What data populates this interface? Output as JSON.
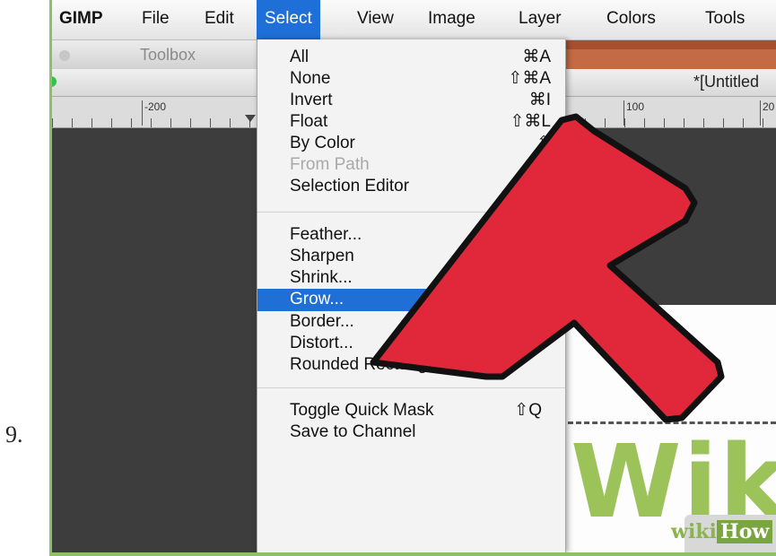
{
  "step_number": "9.",
  "menubar": {
    "items": [
      "GIMP",
      "File",
      "Edit",
      "Select",
      "View",
      "Image",
      "Layer",
      "Colors",
      "Tools"
    ]
  },
  "toolbox": {
    "title": "Toolbox"
  },
  "image_window": {
    "title": "*[Untitled"
  },
  "ruler": {
    "labels": [
      "-200",
      "100",
      "20"
    ]
  },
  "select_menu": {
    "items": [
      {
        "label": "All",
        "shortcut": "⌘A"
      },
      {
        "label": "None",
        "shortcut": "⇧⌘A"
      },
      {
        "label": "Invert",
        "shortcut": "⌘I"
      },
      {
        "label": "Float",
        "shortcut": "⇧⌘L"
      },
      {
        "label": "By Color",
        "shortcut": "⇧"
      },
      {
        "label": "From Path",
        "shortcut": ""
      },
      {
        "label": "Selection Editor",
        "shortcut": ""
      },
      {
        "label": "Feather...",
        "shortcut": ""
      },
      {
        "label": "Sharpen",
        "shortcut": ""
      },
      {
        "label": "Shrink...",
        "shortcut": ""
      },
      {
        "label": "Grow...",
        "shortcut": ""
      },
      {
        "label": "Border...",
        "shortcut": ""
      },
      {
        "label": "Distort...",
        "shortcut": ""
      },
      {
        "label": "Rounded Rectangle...",
        "shortcut": ""
      },
      {
        "label": "Toggle Quick Mask",
        "shortcut": "⇧Q"
      },
      {
        "label": "Save to Channel",
        "shortcut": ""
      }
    ],
    "disabled": [
      "From Path"
    ],
    "highlighted": "Grow..."
  },
  "canvas": {
    "text": "Wiki"
  },
  "watermark": {
    "wiki": "wiki",
    "how": "How"
  },
  "colors": {
    "highlight": "#1f6fd6",
    "arrow": "#e0283a",
    "logo_green": "#9cc35a",
    "frame": "#8fbf66"
  }
}
